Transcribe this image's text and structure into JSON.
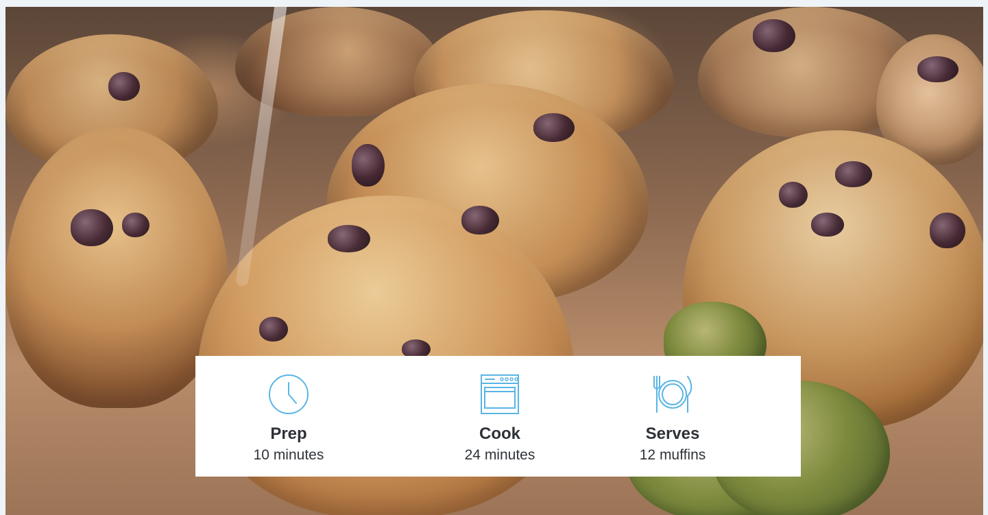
{
  "hero": {
    "image_label": "muffin-hero-image"
  },
  "stats": [
    {
      "icon": "clock-icon",
      "label": "Prep",
      "value": "10 minutes"
    },
    {
      "icon": "oven-icon",
      "label": "Cook",
      "value": "24 minutes"
    },
    {
      "icon": "dining-plate-icon",
      "label": "Serves",
      "value": "12 muffins"
    }
  ],
  "colors": {
    "accent": "#59b4e5",
    "text": "#2f3338",
    "card": "#ffffff",
    "page_background": "#eef3f7"
  }
}
